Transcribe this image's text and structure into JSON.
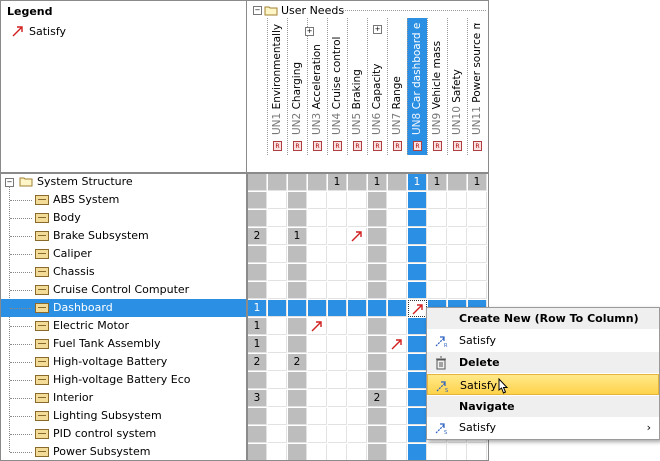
{
  "legend": {
    "title": "Legend",
    "items": [
      {
        "label": "Satisfy",
        "icon": "satisfy-arrow-icon",
        "color": "#d02020"
      }
    ]
  },
  "header": {
    "group_label": "User Needs",
    "columns": [
      {
        "id": "UN1",
        "name": "Environmentally Friendl",
        "mark": "R"
      },
      {
        "id": "UN2",
        "name": "Charging",
        "mark": "R"
      },
      {
        "id": "UN3",
        "name": "Acceleration",
        "mark": "R"
      },
      {
        "id": "UN4",
        "name": "Cruise control",
        "mark": "R"
      },
      {
        "id": "UN5",
        "name": "Braking",
        "mark": "R"
      },
      {
        "id": "UN6",
        "name": "Capacity",
        "mark": "R"
      },
      {
        "id": "UN7",
        "name": "Range",
        "mark": "R"
      },
      {
        "id": "UN8",
        "name": "Car dashboard ergono",
        "mark": "R"
      },
      {
        "id": "UN9",
        "name": "Vehicle mass",
        "mark": "R"
      },
      {
        "id": "UN10",
        "name": "Safety",
        "mark": "R"
      },
      {
        "id": "UN11",
        "name": "Power source manage",
        "mark": "R"
      }
    ]
  },
  "tree": {
    "root": "System Structure",
    "root_counts": [
      "",
      "",
      "",
      "1",
      "",
      "1",
      "",
      "1",
      "1",
      "",
      "1"
    ],
    "rows": [
      {
        "label": "ABS System",
        "count": ""
      },
      {
        "label": "Body",
        "count": ""
      },
      {
        "label": "Brake Subsystem",
        "count": "2",
        "c2": "1"
      },
      {
        "label": "Caliper",
        "count": ""
      },
      {
        "label": "Chassis",
        "count": ""
      },
      {
        "label": "Cruise Control Computer",
        "count": ""
      },
      {
        "label": "Dashboard",
        "count": "1"
      },
      {
        "label": "Electric Motor",
        "count": "1"
      },
      {
        "label": "Fuel Tank Assembly",
        "count": "1"
      },
      {
        "label": "High-voltage Battery",
        "count": "2",
        "c2": "2"
      },
      {
        "label": "High-voltage Battery Eco",
        "count": ""
      },
      {
        "label": "Interior",
        "count": "3",
        "c6": "2"
      },
      {
        "label": "Lighting Subsystem",
        "count": ""
      },
      {
        "label": "PID control system",
        "count": ""
      },
      {
        "label": "Power Subsystem",
        "count": ""
      }
    ]
  },
  "menu": {
    "create_header": "Create New (Row To Column)",
    "create_satisfy": "Satisfy",
    "delete_header": "Delete",
    "delete_satisfy": "Satisfy",
    "navigate_header": "Navigate",
    "navigate_satisfy": "Satisfy",
    "submenu_arrow": "›"
  },
  "colors": {
    "selection": "#2b8fe3",
    "gray_cell": "#bdbdbd",
    "arrow": "#d02020"
  }
}
